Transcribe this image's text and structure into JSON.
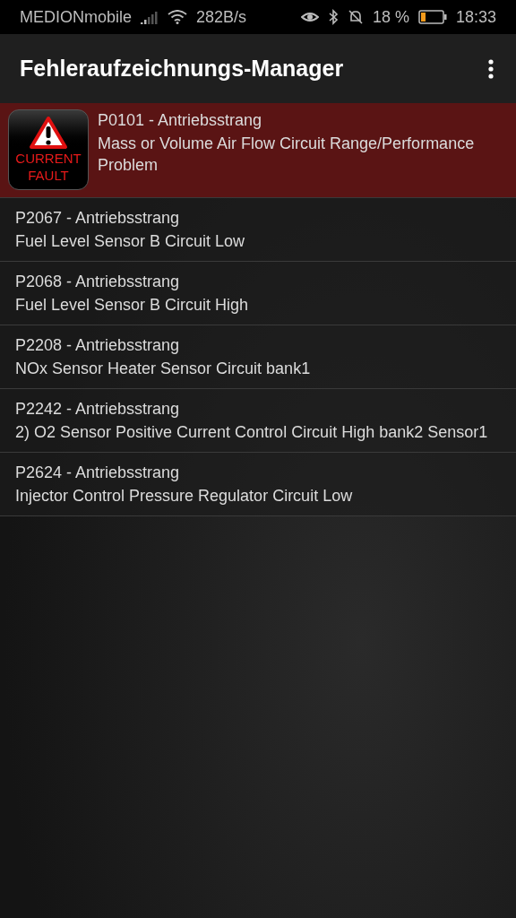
{
  "status_bar": {
    "carrier": "MEDIONmobile",
    "speed": "282B/s",
    "battery": "18 %",
    "time": "18:33"
  },
  "app_bar": {
    "title": "Fehleraufzeichnungs-Manager"
  },
  "faults": [
    {
      "code": "P0101 - Antriebsstrang",
      "description": "Mass or Volume Air Flow Circuit Range/Performance Problem",
      "current": true,
      "badge": [
        "CURRENT",
        "FAULT"
      ]
    },
    {
      "code": "P2067 - Antriebsstrang",
      "description": "Fuel Level Sensor B Circuit Low",
      "current": false
    },
    {
      "code": "P2068 - Antriebsstrang",
      "description": "Fuel Level Sensor B Circuit High",
      "current": false
    },
    {
      "code": "P2208 - Antriebsstrang",
      "description": "NOx Sensor Heater Sensor Circuit bank1",
      "current": false
    },
    {
      "code": "P2242 - Antriebsstrang",
      "description": "2) O2 Sensor Positive Current Control Circuit High bank2 Sensor1",
      "current": false
    },
    {
      "code": "P2624 - Antriebsstrang",
      "description": "Injector Control Pressure Regulator Circuit Low",
      "current": false
    }
  ]
}
